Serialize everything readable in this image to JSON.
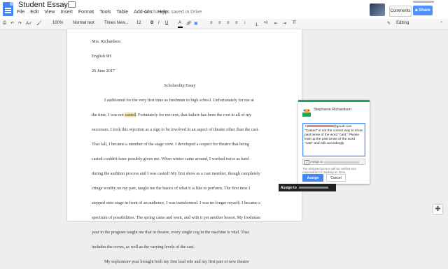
{
  "app": {
    "doc_title": "Student Essay",
    "saved_status": "All changes saved in Drive",
    "comments_label": "Comments",
    "share_label": "Share"
  },
  "menu": [
    "File",
    "Edit",
    "View",
    "Insert",
    "Format",
    "Tools",
    "Table",
    "Add-ons",
    "Help"
  ],
  "toolbar": {
    "zoom": "100%",
    "style": "Normal text",
    "font": "Times New...",
    "size": "12",
    "mode": "Editing"
  },
  "document": {
    "header_lines": [
      "Mrs. Richardson",
      "English 9H",
      "26 June 2017"
    ],
    "title": "Scholarship Essay",
    "line1": "I auditioned for the very first time as freshman in high school. Unfortunately for me at",
    "line2_before": "the time, I was not ",
    "line2_highlight": "casted",
    "line2_after": ". Fortunately for me now, that failure has been the root to all of my",
    "lines": [
      "successes. I took this rejection as a sign to be involved in an aspect of theatre other than the cast.",
      "That fall, I became a member of the stage crew. I developed a respect for theatre that being",
      "casted couldn't have possibly given me. When winter came around, I worked twice as hard",
      "during the audition process and I was casted! My first show as a cast member, though completely",
      "cringe worthy on my part, taught me the basics of what it is like to perform. The first time I",
      "stepped onto stage in front of an audience, I was transformed. I was no longer myself; I became a",
      "spectrum of possibilities. The spring came and went, and with it yet another lesson. My freshman",
      "year in the program taught me that in theatre, every single cog in the machine is vital. That",
      "includes the crews, as well as the varying levels of the cast."
    ],
    "cutoff_line": "My sophomore year brought both my first lead role and my first pair of new theatre"
  },
  "comment": {
    "author": "Stephanie Richardson",
    "mention_prefix": "+",
    "mention_suffix": "@gmail.com",
    "body": "\"Casted\" is not the correct way to show past tense of the word \"cast.\" Please look up the past tense of the word \"cast\" and edit accordingly.",
    "assign_label": "Assign to",
    "assign_note": "The assigned person will be notified and responsible for marking as done.",
    "assign_button": "Assign",
    "cancel_button": "Cancel",
    "tooltip_label": "Assign to"
  },
  "colors": {
    "accent_blue": "#4285f4",
    "highlight": "#f6e3a8",
    "comment_green": "#1ea362"
  }
}
